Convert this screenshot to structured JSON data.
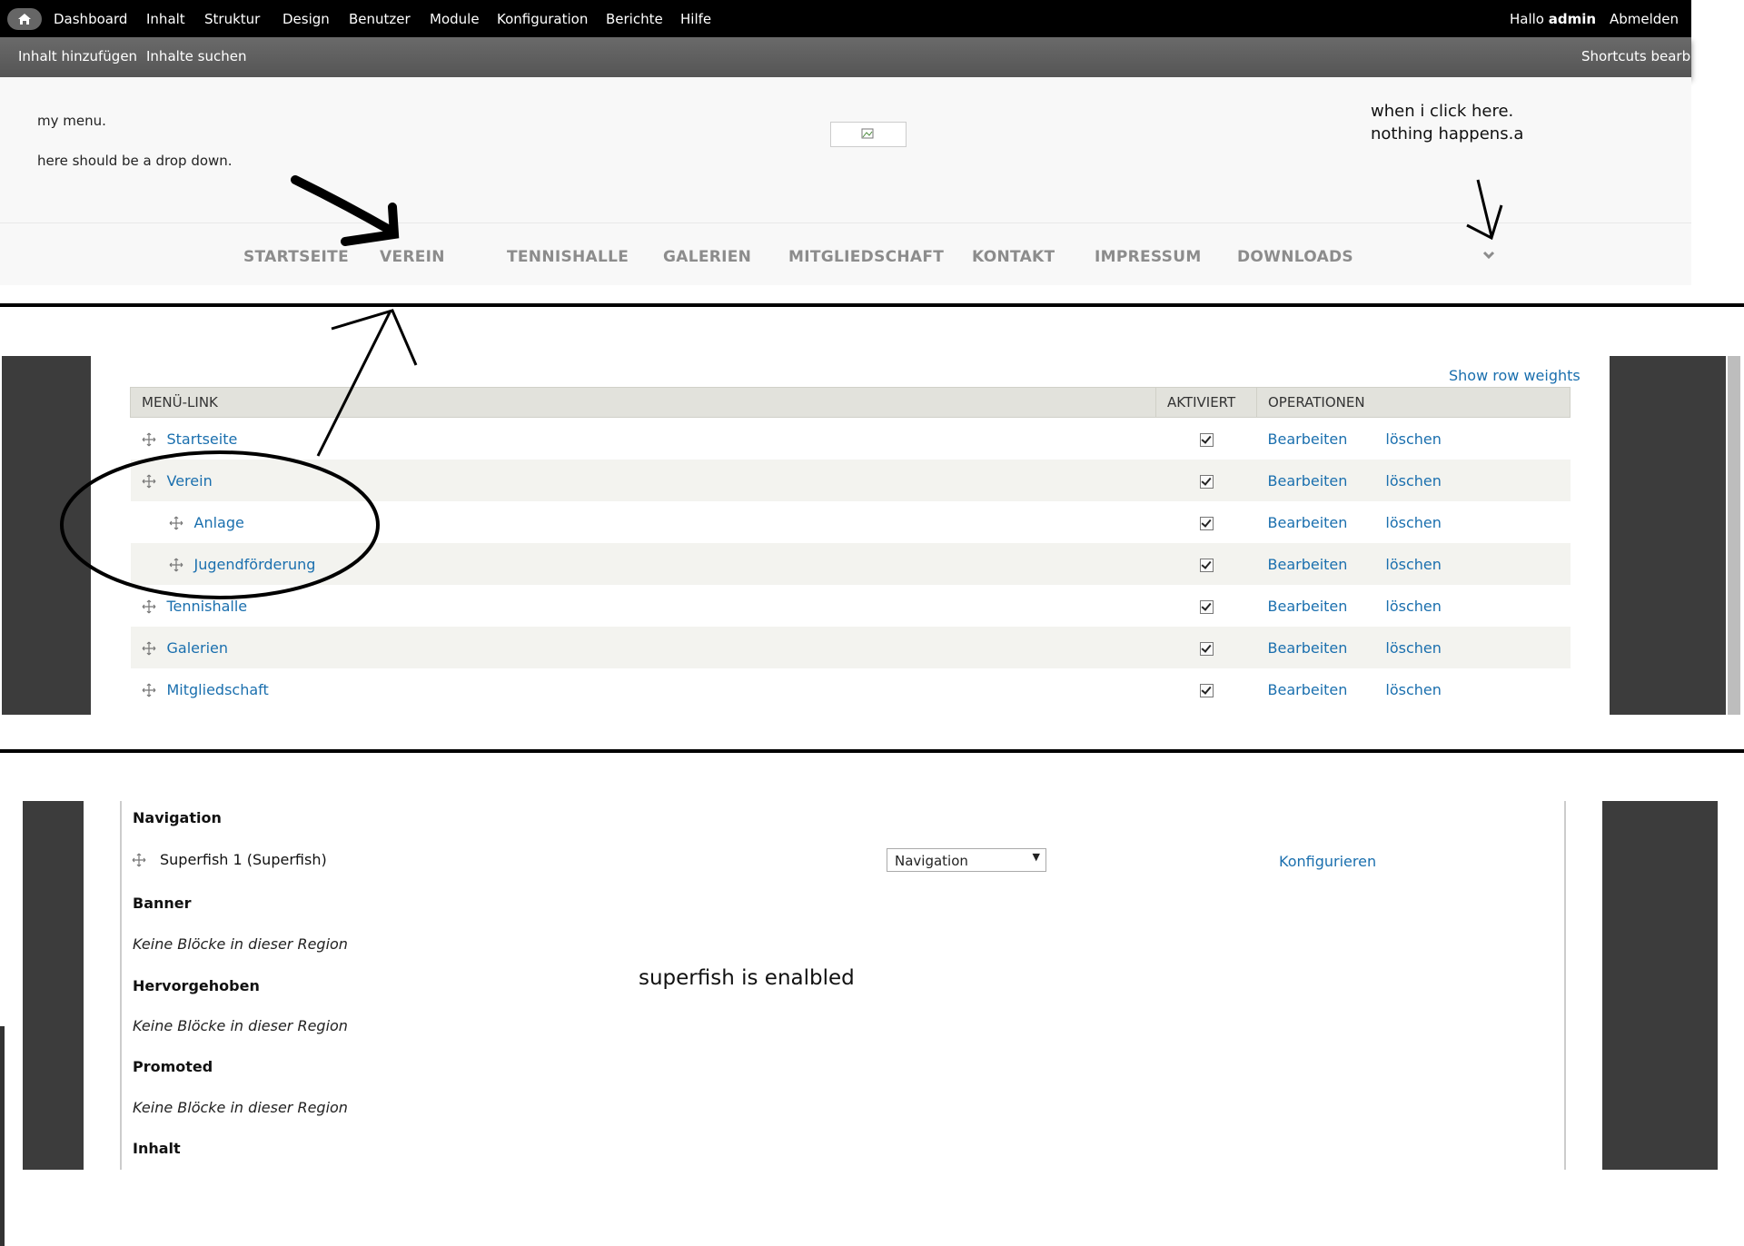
{
  "toolbar": {
    "left_items": [
      "Dashboard",
      "Inhalt",
      "Struktur",
      "Design",
      "Benutzer",
      "Module",
      "Konfiguration",
      "Berichte",
      "Hilfe"
    ],
    "greeting": "Hallo",
    "username": "admin",
    "logout": "Abmelden"
  },
  "shortcuts": {
    "items": [
      "Inhalt hinzufügen",
      "Inhalte suchen"
    ],
    "edit": "Shortcuts bearbeiten"
  },
  "header_notes": {
    "left_line1": "my menu.",
    "left_line2": "here should be a drop down.",
    "right_line1": "when i click here.",
    "right_line2": "nothing happens.a"
  },
  "main_nav": {
    "items": [
      "STARTSEITE",
      "VEREIN",
      "TENNISHALLE",
      "GALERIEN",
      "MITGLIEDSCHAFT",
      "KONTAKT",
      "IMPRESSUM",
      "DOWNLOADS"
    ],
    "expand_icon": "chevron-down-icon"
  },
  "menu_table": {
    "show_weights": "Show row weights",
    "headers": [
      "MENÜ-LINK",
      "AKTIVIERT",
      "OPERATIONEN"
    ],
    "rows": [
      {
        "label": "Startseite",
        "level": 0,
        "enabled": true
      },
      {
        "label": "Verein",
        "level": 0,
        "enabled": true
      },
      {
        "label": "Anlage",
        "level": 1,
        "enabled": true
      },
      {
        "label": "Jugendförderung",
        "level": 1,
        "enabled": true
      },
      {
        "label": "Tennishalle",
        "level": 0,
        "enabled": true
      },
      {
        "label": "Galerien",
        "level": 0,
        "enabled": true
      },
      {
        "label": "Mitgliedschaft",
        "level": 0,
        "enabled": true
      }
    ],
    "edit_label": "Bearbeiten",
    "delete_label": "löschen"
  },
  "block_layout": {
    "regions": [
      {
        "title": "Navigation",
        "block": "Superfish 1 (Superfish)"
      },
      {
        "title": "Banner",
        "empty": "Keine Blöcke in dieser Region"
      },
      {
        "title": "Hervorgehoben",
        "empty": "Keine Blöcke in dieser Region"
      },
      {
        "title": "Promoted",
        "empty": "Keine Blöcke in dieser Region"
      },
      {
        "title": "Inhalt"
      }
    ],
    "region_select_value": "Navigation",
    "configure_label": "Konfigurieren",
    "note": "superfish is enalbled"
  },
  "colors": {
    "link": "#1a6fae",
    "toolbar_bg": "#000000",
    "shortcut_bg": "#5e5e5e",
    "nav_text": "#8c8c8c",
    "side_panel": "#3c3c3c"
  }
}
